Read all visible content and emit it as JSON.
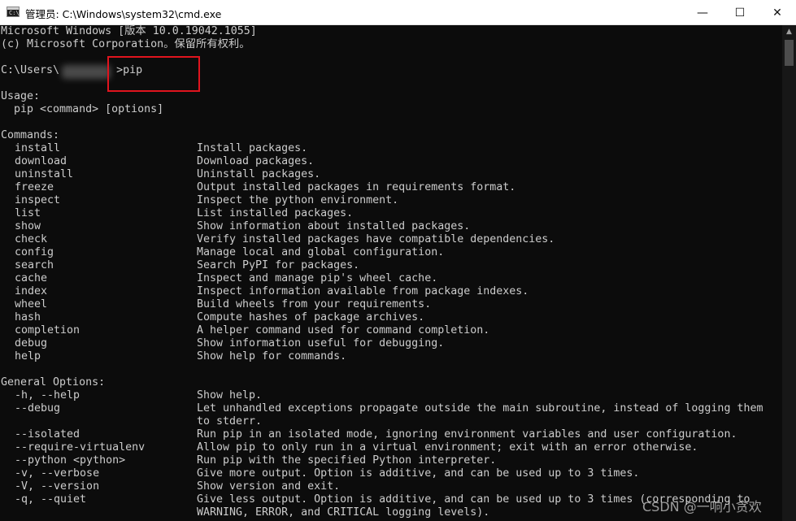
{
  "window": {
    "title": "管理员: C:\\Windows\\system32\\cmd.exe",
    "icon_label": "C:\\",
    "minimize": "—",
    "maximize": "☐",
    "close": "✕"
  },
  "scrollbar": {
    "up_arrow": "▲"
  },
  "watermark": "CSDN @一响小贪欢",
  "console": {
    "banner": [
      "Microsoft Windows [版本 10.0.19042.1055]",
      "(c) Microsoft Corporation。保留所有权利。"
    ],
    "prompt": {
      "prefix": "C:\\Users\\",
      "command": ">pip"
    },
    "usage_header": "Usage:",
    "usage_line": "  pip <command> [options]",
    "commands_header": "Commands:",
    "commands": [
      {
        "name": "install",
        "desc": "Install packages."
      },
      {
        "name": "download",
        "desc": "Download packages."
      },
      {
        "name": "uninstall",
        "desc": "Uninstall packages."
      },
      {
        "name": "freeze",
        "desc": "Output installed packages in requirements format."
      },
      {
        "name": "inspect",
        "desc": "Inspect the python environment."
      },
      {
        "name": "list",
        "desc": "List installed packages."
      },
      {
        "name": "show",
        "desc": "Show information about installed packages."
      },
      {
        "name": "check",
        "desc": "Verify installed packages have compatible dependencies."
      },
      {
        "name": "config",
        "desc": "Manage local and global configuration."
      },
      {
        "name": "search",
        "desc": "Search PyPI for packages."
      },
      {
        "name": "cache",
        "desc": "Inspect and manage pip's wheel cache."
      },
      {
        "name": "index",
        "desc": "Inspect information available from package indexes."
      },
      {
        "name": "wheel",
        "desc": "Build wheels from your requirements."
      },
      {
        "name": "hash",
        "desc": "Compute hashes of package archives."
      },
      {
        "name": "completion",
        "desc": "A helper command used for command completion."
      },
      {
        "name": "debug",
        "desc": "Show information useful for debugging."
      },
      {
        "name": "help",
        "desc": "Show help for commands."
      }
    ],
    "general_header": "General Options:",
    "options": [
      {
        "name": "-h, --help",
        "desc": "Show help."
      },
      {
        "name": "--debug",
        "desc": "Let unhandled exceptions propagate outside the main subroutine, instead of logging them"
      },
      {
        "name": "",
        "desc": "to stderr."
      },
      {
        "name": "--isolated",
        "desc": "Run pip in an isolated mode, ignoring environment variables and user configuration."
      },
      {
        "name": "--require-virtualenv",
        "desc": "Allow pip to only run in a virtual environment; exit with an error otherwise."
      },
      {
        "name": "--python <python>",
        "desc": "Run pip with the specified Python interpreter."
      },
      {
        "name": "-v, --verbose",
        "desc": "Give more output. Option is additive, and can be used up to 3 times."
      },
      {
        "name": "-V, --version",
        "desc": "Show version and exit."
      },
      {
        "name": "-q, --quiet",
        "desc": "Give less output. Option is additive, and can be used up to 3 times (corresponding to"
      },
      {
        "name": "",
        "desc": "WARNING, ERROR, and CRITICAL logging levels)."
      }
    ]
  }
}
